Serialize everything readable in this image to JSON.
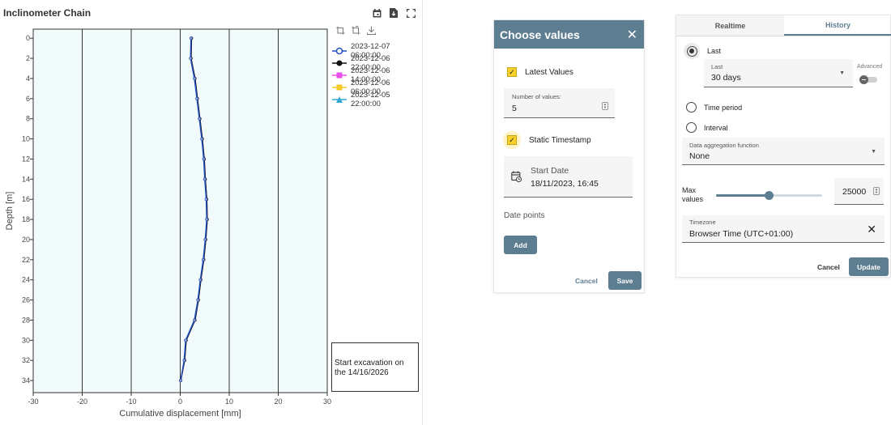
{
  "widget": {
    "title": "Inclinometer Chain",
    "tools": [
      "calendar-icon",
      "export-file-icon",
      "fullscreen-icon"
    ],
    "legend_tools": [
      "zoom-select-icon",
      "zoom-reset-icon",
      "download-icon"
    ],
    "annotation": "Start excavation on the 14/16/2026"
  },
  "chart_data": {
    "type": "line",
    "xlabel": "Cumulative displacement [mm]",
    "ylabel": "Depth [m]",
    "xlim": [
      -30,
      30
    ],
    "ylim": [
      0,
      34
    ],
    "y_inverted": true,
    "x_ticks": [
      -30,
      -20,
      -10,
      0,
      10,
      20,
      30
    ],
    "y_ticks": [
      0,
      2,
      4,
      6,
      8,
      10,
      12,
      14,
      16,
      18,
      20,
      22,
      24,
      26,
      28,
      30,
      32,
      34
    ],
    "x_grid": true,
    "plot_background": "#f2fbfb",
    "legend_position": "right",
    "depth": [
      0,
      2,
      4,
      6,
      8,
      10,
      12,
      14,
      16,
      18,
      20,
      22,
      24,
      26,
      28,
      30,
      32,
      34
    ],
    "series": [
      {
        "name": "2023-12-07 06:00:00",
        "color": "#1f4fbf",
        "marker": "circle-open",
        "values": [
          2.2,
          2.1,
          2.9,
          3.4,
          3.9,
          4.4,
          4.8,
          5.0,
          5.3,
          5.4,
          5.1,
          4.7,
          4.1,
          3.6,
          2.9,
          1.1,
          0.8,
          0.1
        ]
      },
      {
        "name": "2023-12-06 22:00:00",
        "color": "#111111",
        "marker": "circle",
        "values": [
          2.3,
          2.2,
          3.0,
          3.5,
          4.0,
          4.5,
          4.9,
          5.1,
          5.4,
          5.5,
          5.2,
          4.8,
          4.2,
          3.7,
          3.0,
          1.2,
          0.9,
          0.1
        ]
      },
      {
        "name": "2023-12-06 14:00:00",
        "color": "#e84ee8",
        "marker": "square",
        "values": [
          2.3,
          2.2,
          3.0,
          3.5,
          4.0,
          4.5,
          4.9,
          5.1,
          5.4,
          5.5,
          5.2,
          4.8,
          4.2,
          3.7,
          3.0,
          1.2,
          0.9,
          0.1
        ]
      },
      {
        "name": "2023-12-06 06:00:00",
        "color": "#f5c92a",
        "marker": "square",
        "values": [
          2.3,
          2.2,
          3.0,
          3.5,
          4.0,
          4.5,
          4.9,
          5.1,
          5.4,
          5.5,
          5.2,
          4.8,
          4.2,
          3.7,
          3.0,
          1.2,
          0.9,
          0.1
        ]
      },
      {
        "name": "2023-12-05 22:00:00",
        "color": "#35a9d6",
        "marker": "triangle",
        "values": [
          2.3,
          2.2,
          3.0,
          3.5,
          4.0,
          4.5,
          4.9,
          5.1,
          5.4,
          5.5,
          5.2,
          4.8,
          4.2,
          3.7,
          3.0,
          1.2,
          0.9,
          0.1
        ]
      }
    ]
  },
  "choose_values": {
    "title": "Choose values",
    "close_icon": "close-icon",
    "latest_values_label": "Latest Values",
    "latest_values_checked": true,
    "number_of_values_label": "Number of values:",
    "number_of_values": "5",
    "static_timestamp_label": "Static Timestamp",
    "static_timestamp_checked": true,
    "start_date_label": "Start Date",
    "start_date_value": "18/11/2023, 16:45",
    "date_points_label": "Date points",
    "add_label": "Add",
    "cancel_label": "Cancel",
    "save_label": "Save",
    "accent_color": "#5d7d91",
    "checkbox_color": "#f7d02c"
  },
  "history_panel": {
    "tabs": [
      {
        "label": "Realtime",
        "active": false
      },
      {
        "label": "History",
        "active": true
      }
    ],
    "last_label": "Last",
    "last_field_label": "Last",
    "last_field_value": "30 days",
    "advanced_label": "Advanced",
    "time_period_label": "Time period",
    "interval_label": "Interval",
    "aggregation_label": "Data aggregation function",
    "aggregation_value": "None",
    "max_values_label": "Max\nvalues",
    "max_values": "25000",
    "slider_fraction": 0.5,
    "timezone_label": "Timezone",
    "timezone_value": "Browser Time (UTC+01:00)",
    "cancel_label": "Cancel",
    "update_label": "Update"
  }
}
